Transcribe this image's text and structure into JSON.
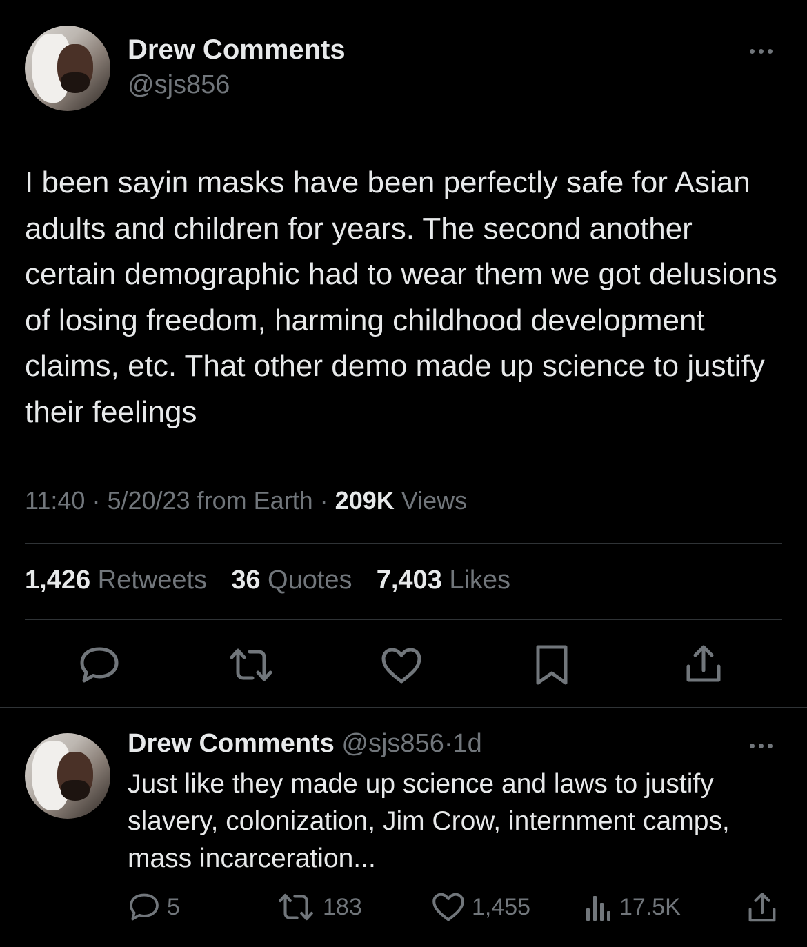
{
  "tweet": {
    "author_name": "Drew Comments",
    "author_handle": "@sjs856",
    "body": "I been sayin masks have been perfectly safe for Asian adults and children for years. The second another certain demographic had to wear them we got delusions of losing freedom, harming childhood development claims, etc. That other demo made up science to justify their feelings",
    "time": "11:40",
    "date": "5/20/23",
    "source": "from Earth",
    "views_count": "209K",
    "views_label": "Views",
    "retweets_count": "1,426",
    "retweets_label": "Retweets",
    "quotes_count": "36",
    "quotes_label": "Quotes",
    "likes_count": "7,403",
    "likes_label": "Likes",
    "sep": "·"
  },
  "reply": {
    "author_name": "Drew Comments",
    "author_handle": "@sjs856",
    "age": "1d",
    "body": "Just like they made up science and laws to justify slavery, colonization, Jim Crow, internment camps, mass incarceration...",
    "replies": "5",
    "retweets": "183",
    "likes": "1,455",
    "views": "17.5K"
  },
  "icons": [
    "more-icon",
    "reply-icon",
    "retweet-icon",
    "like-icon",
    "bookmark-icon",
    "share-icon",
    "views-icon"
  ],
  "colors": {
    "background": "#000000",
    "text": "#e7e9ea",
    "muted": "#71767b",
    "divider": "#2f3336"
  }
}
